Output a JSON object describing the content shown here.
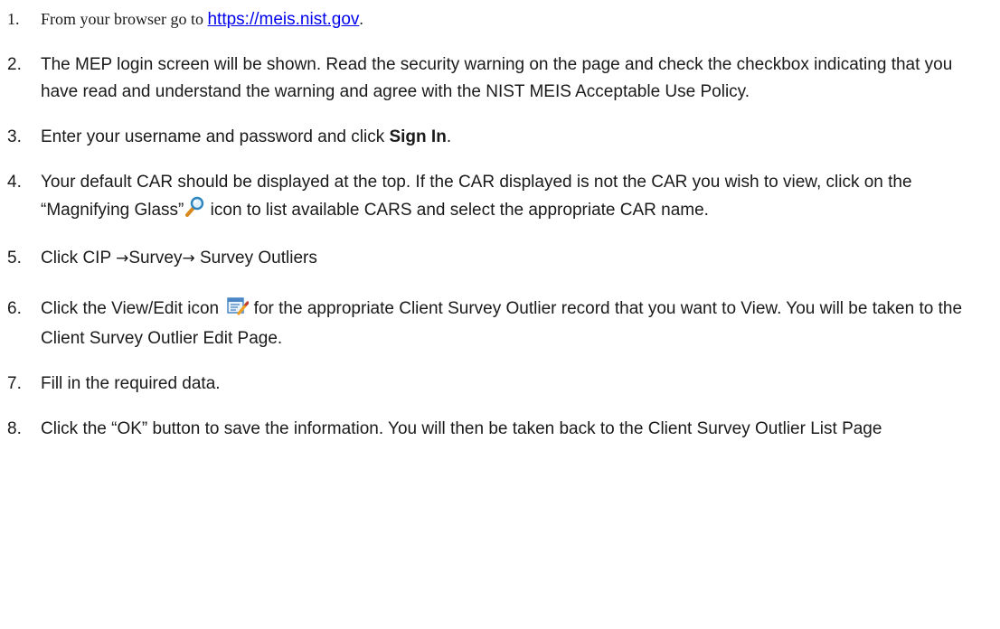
{
  "steps": [
    {
      "num": "1.",
      "text_before": "From your browser go to ",
      "link": "https://meis.nist.gov",
      "text_after": "."
    },
    {
      "num": "2.",
      "text": "The MEP login screen will be shown.  Read the security warning on the page and check the checkbox indicating that you have read and understand the warning and agree with the NIST MEIS Acceptable Use Policy."
    },
    {
      "num": "3.",
      "text_before": "Enter your username and password and click ",
      "bold": "Sign In",
      "text_after": "."
    },
    {
      "num": "4.",
      "text_before": "Your default CAR should be displayed at the top.  If the CAR displayed is not the CAR you wish to view, click on the “Magnifying Glass”",
      "text_after": " icon to list available CARS and select the appropriate CAR name.",
      "icon": "magnifying-glass-icon"
    },
    {
      "num": "5.",
      "part1": "Click CIP ",
      "arrow1": "→",
      "part2": "Survey",
      "arrow2": "→",
      "part3": " Survey Outliers"
    },
    {
      "num": "6.",
      "text_before": "Click the View/Edit icon ",
      "text_after": " for the appropriate Client Survey Outlier record that you want to View. You will be taken to the Client Survey Outlier Edit Page.",
      "icon": "view-edit-icon"
    },
    {
      "num": "7.",
      "text": "Fill in the required data."
    },
    {
      "num": "8.",
      "text": "Click the “OK” button to save the information. You will then be taken back to the Client Survey Outlier List Page"
    }
  ]
}
